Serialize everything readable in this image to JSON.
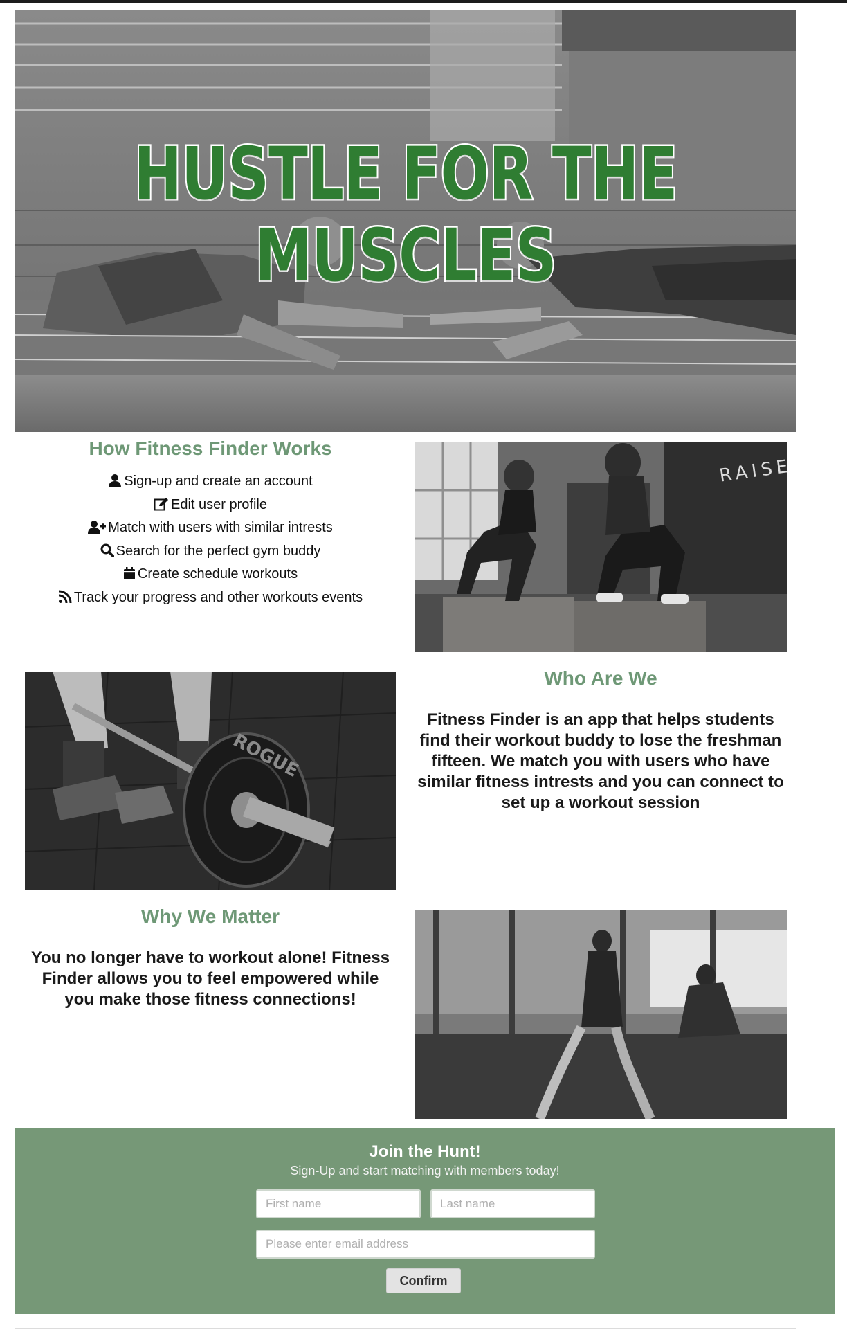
{
  "hero": {
    "title": "HUSTLE FOR THE MUSCLES"
  },
  "how_it_works": {
    "title": "How Fitness Finder Works",
    "items": [
      {
        "icon": "user-icon",
        "label": "Sign-up and create an account"
      },
      {
        "icon": "edit-icon",
        "label": "Edit user profile"
      },
      {
        "icon": "user-plus-icon",
        "label": "Match with users with similar intrests"
      },
      {
        "icon": "search-icon",
        "label": "Search for the perfect gym buddy"
      },
      {
        "icon": "calendar-icon",
        "label": "Create schedule workouts"
      },
      {
        "icon": "rss-icon",
        "label": "Track your progress and other workouts events"
      }
    ]
  },
  "who_we_are": {
    "title": "Who Are We",
    "text": "Fitness Finder is an app that helps students find their workout buddy to lose the freshman fifteen. We match you with users who have similar fitness intrests and you can connect to set up a workout session"
  },
  "why_we_matter": {
    "title": "Why We Matter",
    "text": "You no longer have to workout alone! Fitness Finder allows you to feel empowered while you make those fitness connections!"
  },
  "photos": {
    "box_jump_sign": "RAISE THE BAR",
    "plate_text": "ROGUE"
  },
  "join": {
    "title": "Join the Hunt!",
    "subtitle": "Sign-Up and start matching with members today!",
    "first_name_placeholder": "First name",
    "last_name_placeholder": "Last name",
    "email_placeholder": "Please enter email address",
    "confirm_label": "Confirm"
  },
  "colors": {
    "accent": "#769877",
    "heading": "#6e9876",
    "hero_text": "#2f7d32"
  }
}
